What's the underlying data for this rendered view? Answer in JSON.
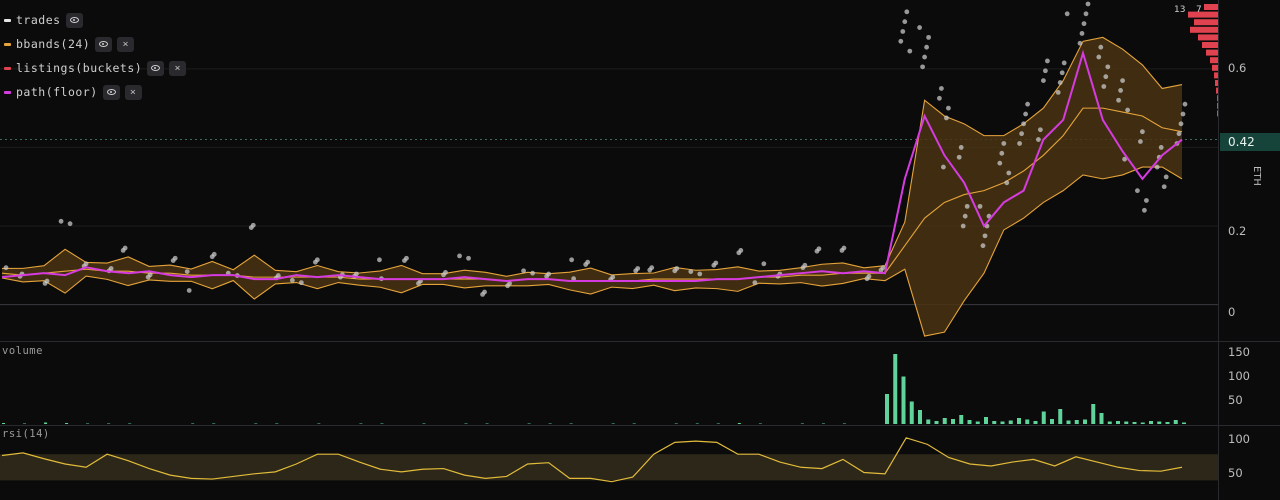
{
  "legend": [
    {
      "label": "trades",
      "color": "#e6e6e6",
      "has_close": false
    },
    {
      "label": "bbands(24)",
      "color": "#e5a33a",
      "has_close": true
    },
    {
      "label": "listings(buckets)",
      "color": "#e0424f",
      "has_close": true
    },
    {
      "label": "path(floor)",
      "color": "#d63be0",
      "has_close": true
    }
  ],
  "close_glyph": "×",
  "price_axis": {
    "ticks": [
      "0.6",
      "0.2",
      "0"
    ],
    "current": "0.42",
    "unit": "ETH"
  },
  "volume_pane": {
    "label": "volume",
    "ticks": [
      "150",
      "100",
      "50"
    ]
  },
  "rsi_pane": {
    "label": "rsi(14)",
    "ticks": [
      "100",
      "50"
    ]
  },
  "listings_hist": {
    "labels": [
      "13",
      "7"
    ]
  },
  "colors": {
    "trades": "#c8c8c8",
    "bband": "#e5a33a",
    "band_fill": "#4a3413",
    "floor": "#d63be0",
    "listings": "#e0424f",
    "volume": "#5fd39a",
    "rsi": "#e2bb3a",
    "rsi_band": "#2c2719",
    "grid": "#1c1c1e"
  },
  "chart_data": [
    {
      "type": "scatter",
      "title": "",
      "ylabel": "ETH",
      "ylim": [
        -0.09,
        0.77
      ],
      "series": [
        {
          "name": "path(floor)",
          "values": [
            0.07,
            0.075,
            0.08,
            0.075,
            0.095,
            0.085,
            0.08,
            0.085,
            0.075,
            0.07,
            0.075,
            0.075,
            0.065,
            0.065,
            0.075,
            0.07,
            0.075,
            0.07,
            0.065,
            0.065,
            0.065,
            0.065,
            0.07,
            0.065,
            0.06,
            0.065,
            0.065,
            0.06,
            0.06,
            0.06,
            0.06,
            0.06,
            0.06,
            0.06,
            0.065,
            0.065,
            0.07,
            0.075,
            0.08,
            0.085,
            0.08,
            0.085,
            0.08,
            0.32,
            0.48,
            0.38,
            0.31,
            0.2,
            0.26,
            0.29,
            0.42,
            0.47,
            0.64,
            0.47,
            0.39,
            0.32,
            0.38,
            0.42
          ]
        },
        {
          "name": "bbands(24)",
          "values": [
            0.08,
            0.075,
            0.08,
            0.085,
            0.09,
            0.085,
            0.085,
            0.08,
            0.08,
            0.075,
            0.075,
            0.075,
            0.07,
            0.07,
            0.07,
            0.07,
            0.07,
            0.065,
            0.065,
            0.065,
            0.065,
            0.065,
            0.065,
            0.065,
            0.06,
            0.065,
            0.065,
            0.06,
            0.06,
            0.06,
            0.06,
            0.065,
            0.065,
            0.065,
            0.065,
            0.065,
            0.07,
            0.07,
            0.075,
            0.075,
            0.08,
            0.08,
            0.08,
            0.15,
            0.22,
            0.26,
            0.28,
            0.29,
            0.31,
            0.34,
            0.38,
            0.43,
            0.5,
            0.5,
            0.49,
            0.48,
            0.45,
            0.44
          ]
        },
        {
          "name": "trades",
          "values": [
            0.07,
            0.09,
            0.06,
            0.2,
            0.08,
            0.11,
            0.15,
            0.07,
            0.1,
            0.06,
            0.14,
            0.08,
            0.19,
            0.05,
            0.08,
            0.12,
            0.07,
            0.06,
            0.09,
            0.13,
            0.06,
            0.07,
            0.1,
            0.05,
            0.06,
            0.08,
            0.06,
            0.09,
            0.12,
            0.07,
            0.08,
            0.07,
            0.11,
            0.09,
            0.1,
            0.12,
            0.08,
            0.09,
            0.1,
            0.13,
            0.12,
            0.09,
            0.1,
            0.72,
            0.63,
            0.45,
            0.3,
            0.25,
            0.36,
            0.41,
            0.52,
            0.64,
            0.74,
            0.58,
            0.47,
            0.34,
            0.4,
            0.46
          ]
        }
      ]
    },
    {
      "type": "bar",
      "title": "volume",
      "ylim": [
        0,
        160
      ],
      "series": [
        {
          "name": "volume",
          "values": [
            2,
            1,
            3,
            2,
            1,
            1,
            1,
            0,
            0,
            1,
            1,
            0,
            1,
            1,
            0,
            1,
            0,
            1,
            1,
            0,
            1,
            0,
            1,
            1,
            0,
            1,
            1,
            1,
            0,
            1,
            1,
            0,
            1,
            1,
            1,
            2,
            1,
            0,
            1,
            1,
            1,
            0,
            1,
            60,
            140,
            95,
            45,
            28,
            9,
            6,
            12,
            10,
            18,
            8,
            5,
            14,
            6,
            5,
            7,
            12,
            9,
            6,
            25,
            10,
            30,
            7,
            8,
            9,
            40,
            22,
            5,
            6,
            5,
            4,
            3,
            6,
            5,
            4,
            8,
            3
          ]
        }
      ]
    },
    {
      "type": "line",
      "title": "rsi(14)",
      "ylim": [
        0,
        110
      ],
      "series": [
        {
          "name": "rsi(14)",
          "values": [
            68,
            72,
            63,
            55,
            50,
            70,
            60,
            48,
            38,
            33,
            32,
            36,
            40,
            43,
            55,
            70,
            70,
            58,
            47,
            43,
            47,
            48,
            38,
            33,
            36,
            55,
            57,
            33,
            33,
            28,
            35,
            70,
            88,
            90,
            88,
            70,
            70,
            58,
            50,
            48,
            62,
            42,
            40,
            95,
            85,
            65,
            55,
            52,
            58,
            62,
            52,
            66,
            58,
            50,
            45,
            44,
            50
          ]
        }
      ]
    }
  ]
}
